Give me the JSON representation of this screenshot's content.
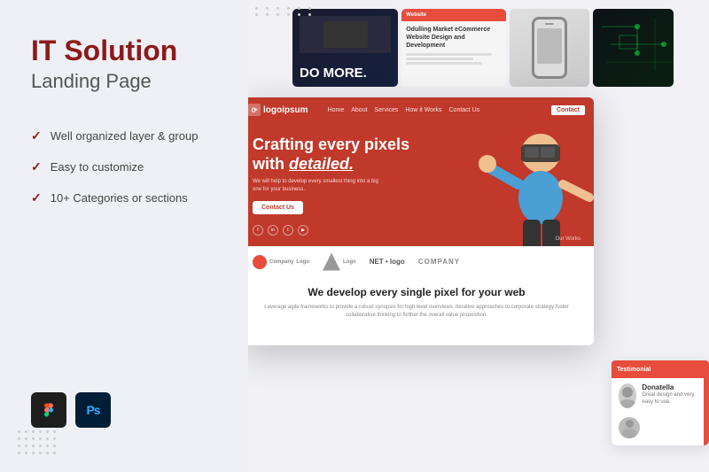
{
  "page": {
    "title": "IT Solution",
    "subtitle": "Landing Page",
    "background_color": "#eef0f5",
    "accent_color": "#8B1A1A"
  },
  "features": [
    {
      "id": 1,
      "text": "Well organized layer & group"
    },
    {
      "id": 2,
      "text": "Easy to customize"
    },
    {
      "id": 3,
      "text": "10+ Categories or sections"
    }
  ],
  "tools": [
    {
      "id": "figma",
      "label": "Figma"
    },
    {
      "id": "photoshop",
      "label": "Ps"
    }
  ],
  "mockup": {
    "nav": {
      "logo": "logoipsum",
      "links": [
        "Home",
        "About",
        "Services",
        "How it Works",
        "Contact Us"
      ],
      "cta": "Contact"
    },
    "hero": {
      "headline": "Crafting every pixels with detailed.",
      "subtext": "We will help to develop every smallest thing into a big one for your business.",
      "cta": "Contact Us"
    },
    "logos_bar": [
      "Company Logo",
      "Logo",
      "NET • logo",
      "COMPANY"
    ],
    "content": {
      "headline": "We develop every single pixel for your web",
      "subtext": "Leverage agile frameworks to provide a robust synopsis for high level overviews. Iterative approaches to corporate strategy foster collaborative thinking to further the overall value proposition."
    }
  },
  "top_cards": {
    "do_more": "DO MORE.",
    "ecommerce_title": "Odulling Market eCommerce Website Design and Development"
  },
  "testimonial": {
    "name": "Donatella",
    "text": "Great design and very easy to use.",
    "header_label": "Testimonial"
  },
  "social_icons": [
    "fb",
    "in",
    "tw",
    "yt"
  ],
  "our_works_label": "Our Works"
}
